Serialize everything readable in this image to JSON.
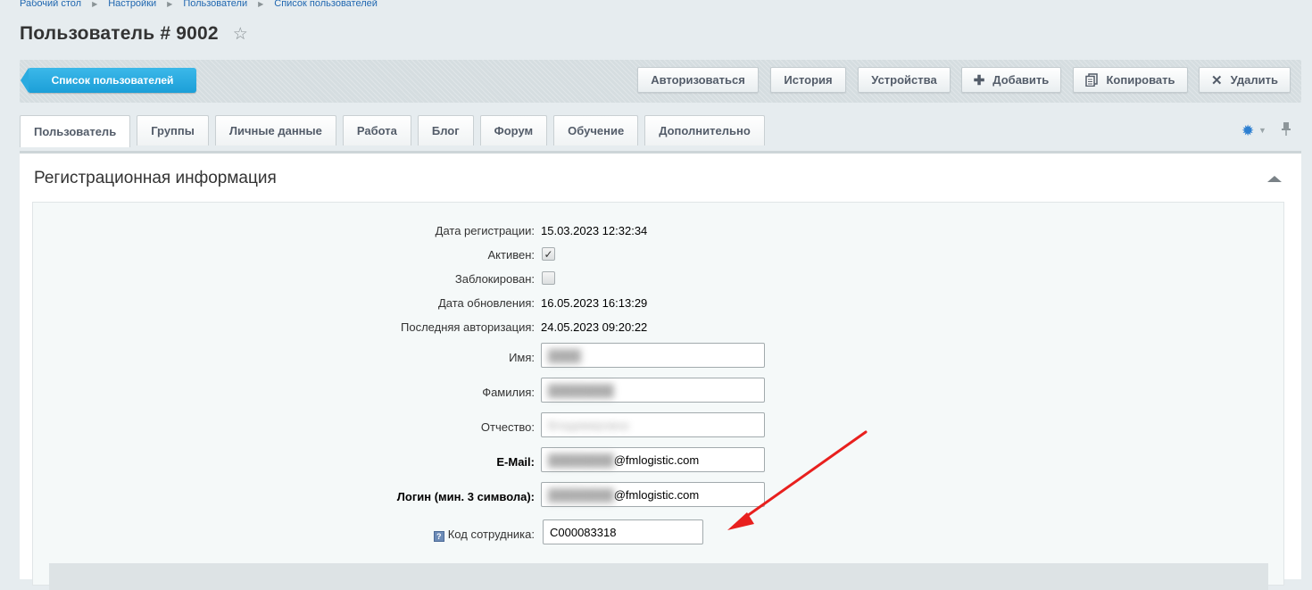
{
  "breadcrumb": [
    "Рабочий стол",
    "Настройки",
    "Пользователи",
    "Список пользователей"
  ],
  "page_title": "Пользователь # 9002",
  "toolbar": {
    "list_button": "Список пользователей",
    "buttons": {
      "authorize": "Авторизоваться",
      "history": "История",
      "devices": "Устройства",
      "add": "Добавить",
      "copy": "Копировать",
      "delete": "Удалить"
    }
  },
  "tabs": [
    "Пользователь",
    "Группы",
    "Личные данные",
    "Работа",
    "Блог",
    "Форум",
    "Обучение",
    "Дополнительно"
  ],
  "section": {
    "title": "Регистрационная информация",
    "fields": {
      "reg_date_label": "Дата регистрации:",
      "reg_date_value": "15.03.2023 12:32:34",
      "active_label": "Активен:",
      "active_checked": true,
      "blocked_label": "Заблокирован:",
      "blocked_checked": false,
      "update_date_label": "Дата обновления:",
      "update_date_value": "16.05.2023 16:13:29",
      "last_auth_label": "Последняя авторизация:",
      "last_auth_value": "24.05.2023 09:20:22",
      "name_label": "Имя:",
      "surname_label": "Фамилия:",
      "patronymic_label": "Отчество:",
      "patronymic_value": "Владимировна",
      "email_label": "E-Mail:",
      "email_domain": "@fmlogistic.com",
      "login_label": "Логин (мин. 3 символа):",
      "login_domain": "@fmlogistic.com",
      "employee_code_label": "Код сотрудника:",
      "employee_code_value": "C000083318"
    }
  },
  "colors": {
    "accent": "#1c9fd8",
    "arrow": "#e8201e",
    "link": "#2067b0"
  },
  "icons": {
    "star": "star-icon",
    "gear": "gear-icon",
    "pin": "pin-icon"
  }
}
